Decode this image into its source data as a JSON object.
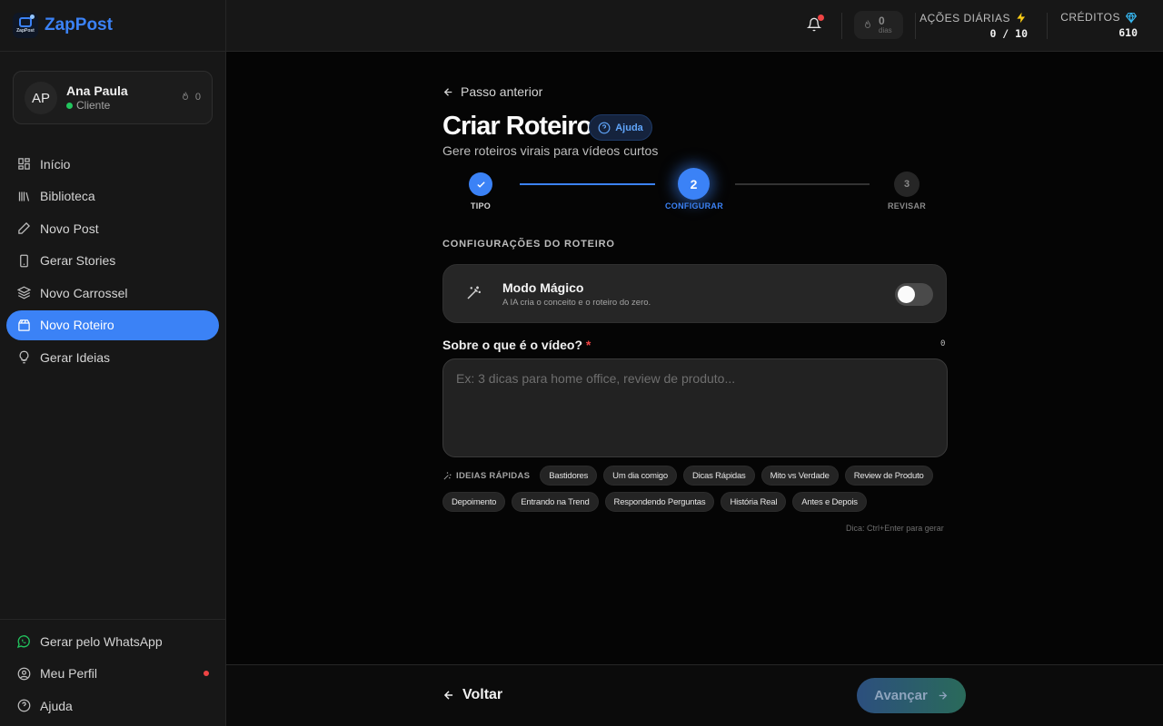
{
  "brand": {
    "name": "ZapPost",
    "logo_small": "ZapPost"
  },
  "user": {
    "initials": "AP",
    "name": "Ana Paula",
    "role": "Cliente",
    "streak": "0"
  },
  "nav": {
    "items": [
      {
        "label": "Início",
        "icon": "grid-icon"
      },
      {
        "label": "Biblioteca",
        "icon": "library-icon"
      },
      {
        "label": "Novo Post",
        "icon": "pen-icon"
      },
      {
        "label": "Gerar Stories",
        "icon": "phone-icon"
      },
      {
        "label": "Novo Carrossel",
        "icon": "layers-icon"
      },
      {
        "label": "Novo Roteiro",
        "icon": "clapperboard-icon",
        "active": true
      },
      {
        "label": "Gerar Ideias",
        "icon": "lightbulb-icon"
      }
    ],
    "bottom": [
      {
        "label": "Gerar pelo WhatsApp",
        "icon": "whatsapp-icon"
      },
      {
        "label": "Meu Perfil",
        "icon": "user-circle-icon"
      },
      {
        "label": "Ajuda",
        "icon": "help-circle-icon"
      }
    ]
  },
  "topbar": {
    "streak": {
      "value": "0",
      "label": "dias"
    },
    "daily_actions": {
      "label": "AÇÕES DIÁRIAS",
      "value": "0 / 10"
    },
    "credits": {
      "label": "CRÉDITOS",
      "value": "610"
    }
  },
  "page": {
    "back_link": "Passo anterior",
    "title": "Criar Roteiro",
    "help_label": "Ajuda",
    "subtitle": "Gere roteiros virais para vídeos curtos"
  },
  "stepper": {
    "steps": [
      {
        "number": "1",
        "label": "TIPO",
        "state": "done"
      },
      {
        "number": "2",
        "label": "CONFIGURAR",
        "state": "active"
      },
      {
        "number": "3",
        "label": "REVISAR",
        "state": "pending"
      }
    ]
  },
  "config": {
    "section_title": "CONFIGURAÇÕES DO ROTEIRO",
    "magic_mode": {
      "title": "Modo Mágico",
      "description": "A IA cria o conceito e o roteiro do zero.",
      "enabled": false
    },
    "topic": {
      "label": "Sobre o que é o vídeo?",
      "required_mark": "*",
      "char_count": "0",
      "value": "",
      "placeholder": "Ex: 3 dicas para home office, review de produto..."
    },
    "quick_ideas_label": "IDEIAS RÁPIDAS",
    "quick_ideas_row1": [
      "Bastidores",
      "Um dia comigo",
      "Dicas Rápidas",
      "Mito vs Verdade",
      "Review de Produto"
    ],
    "quick_ideas_row2": [
      "Depoimento",
      "Entrando na Trend",
      "Respondendo Perguntas",
      "História Real",
      "Antes e Depois"
    ],
    "tip": "Dica: Ctrl+Enter para gerar"
  },
  "footer": {
    "back_label": "Voltar",
    "next_label": "Avançar"
  },
  "colors": {
    "accent": "#3b82f6",
    "bg": "#050505",
    "surface": "#171717",
    "danger": "#ef4444",
    "online": "#22c55e"
  }
}
